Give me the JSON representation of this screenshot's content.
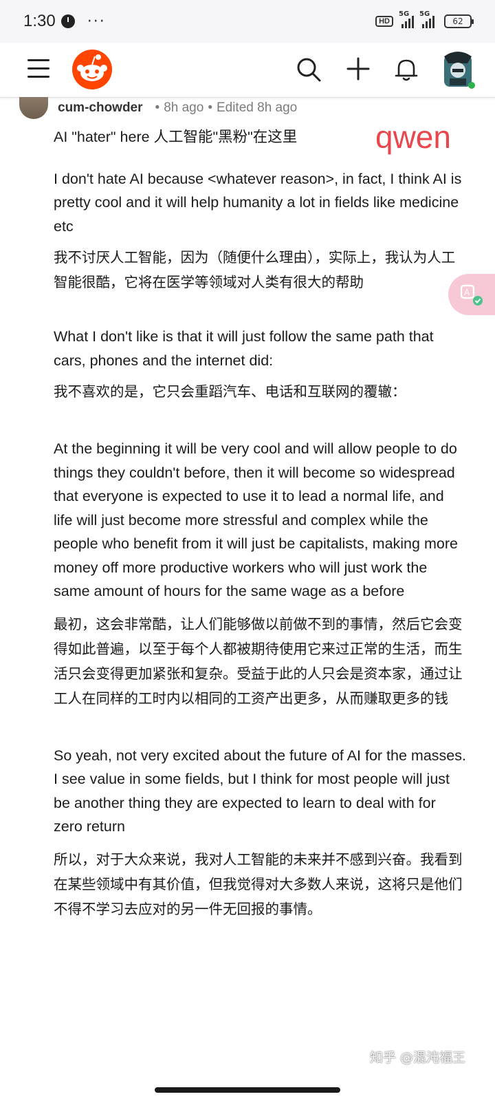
{
  "status_bar": {
    "time": "1:30",
    "more": "···",
    "hd": "HD",
    "network1": "5G",
    "network2": "5G",
    "battery": "62"
  },
  "header": {
    "icons": [
      "menu-icon",
      "reddit-logo",
      "search-icon",
      "plus-icon",
      "bell-icon",
      "user-avatar"
    ],
    "online_color": "#2bb24c"
  },
  "comment": {
    "username": "cum-chowder",
    "time": "8h ago",
    "edited": "Edited 8h ago",
    "paragraphs": [
      {
        "lang": "en",
        "text": "AI \"hater\" here  人工智能\"黑粉\"在这里"
      },
      {
        "lang": "en",
        "text": "I don't hate AI because <whatever reason>, in fact, I think AI is pretty cool and it will help humanity a lot in fields like medicine etc"
      },
      {
        "lang": "zh",
        "text": "我不讨厌人工智能，因为（随便什么理由），实际上，我认为人工智能很酷，它将在医学等领域对人类有很大的帮助"
      },
      {
        "lang": "en",
        "text": "What I don't like is that it will just follow the same path that cars, phones and the internet did:"
      },
      {
        "lang": "zh",
        "text": "我不喜欢的是，它只会重蹈汽车、电话和互联网的覆辙："
      },
      {
        "lang": "en",
        "text": "At the beginning it will be very cool and will allow people to do things they couldn't before, then it will become so widespread that everyone is expected to use it to lead a normal life, and life will just become more stressful and complex while the people who benefit from it will just be capitalists, making more money off more productive workers who will just work the same amount of hours for the same wage as a before"
      },
      {
        "lang": "zh",
        "text": "最初，这会非常酷，让人们能够做以前做不到的事情，然后它会变得如此普遍，以至于每个人都被期待使用它来过正常的生活，而生活只会变得更加紧张和复杂。受益于此的人只会是资本家，通过让工人在同样的工时内以相同的工资产出更多，从而赚取更多的钱"
      },
      {
        "lang": "en",
        "text": "So yeah, not very excited about the future of AI for the masses. I see value in some fields, but I think for most people will just be another thing they are expected to learn to deal with for zero return"
      },
      {
        "lang": "zh",
        "text": "所以，对于大众来说，我对人工智能的未来并不感到兴奋。我看到在某些领域中有其价值，但我觉得对大多数人来说，这将只是他们不得不学习去应对的另一件无回报的事情。"
      }
    ]
  },
  "overlay": {
    "watermark": "qwen",
    "watermark_color": "#e8474d",
    "translate_icon": "translate-icon",
    "zhihu_credit": "知乎 @混沌福王"
  }
}
